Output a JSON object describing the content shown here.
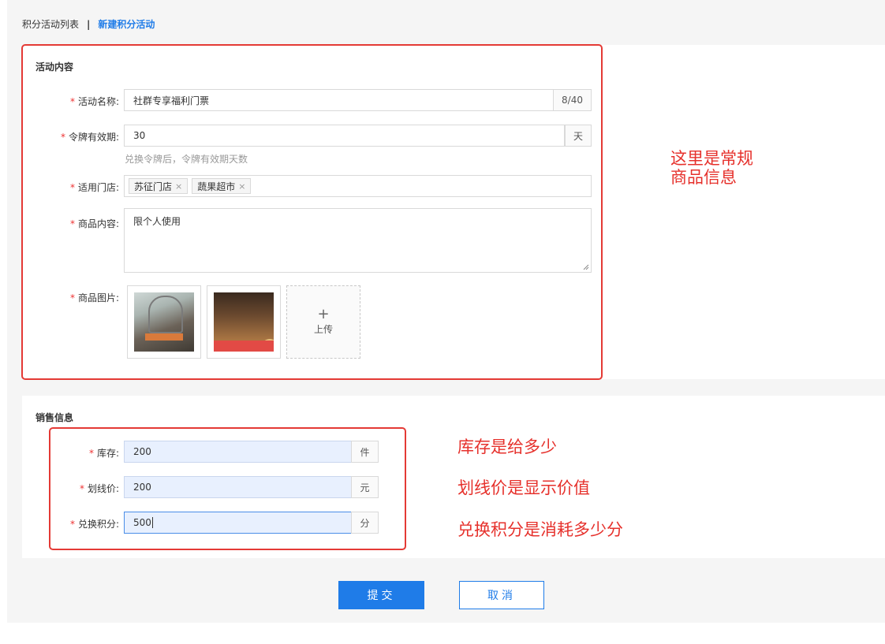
{
  "breadcrumb": {
    "parent": "积分活动列表",
    "separator": "|",
    "current": "新建积分活动"
  },
  "section1": {
    "title": "活动内容",
    "name": {
      "label": "活动名称:",
      "value": "社群专享福利门票",
      "counter": "8/40"
    },
    "validity": {
      "label": "令牌有效期:",
      "value": "30",
      "unit": "天",
      "hint": "兑换令牌后，令牌有效期天数"
    },
    "stores": {
      "label": "适用门店:",
      "tags": [
        "苏征门店",
        "蔬果超市"
      ],
      "remove_glyph": "×"
    },
    "content": {
      "label": "商品内容:",
      "value": "限个人使用"
    },
    "images": {
      "label": "商品图片:",
      "upload_plus": "+",
      "upload_label": "上传"
    }
  },
  "section2": {
    "title": "销售信息",
    "stock": {
      "label": "库存:",
      "value": "200",
      "unit": "件"
    },
    "list_price": {
      "label": "划线价:",
      "value": "200",
      "unit": "元"
    },
    "points": {
      "label": "兑换积分:",
      "value": "500",
      "unit": "分"
    }
  },
  "required_mark": "*",
  "annotations": {
    "general_line1": "这里是常规",
    "general_line2": "商品信息",
    "stock": "库存是给多少",
    "list_price": "划线价是显示价值",
    "points": "兑换积分是消耗多少分"
  },
  "actions": {
    "submit": "提交",
    "cancel": "取消"
  },
  "colors": {
    "primary": "#1f7ce8",
    "annotation_red": "#e43a35",
    "required_red": "#ee3333"
  }
}
